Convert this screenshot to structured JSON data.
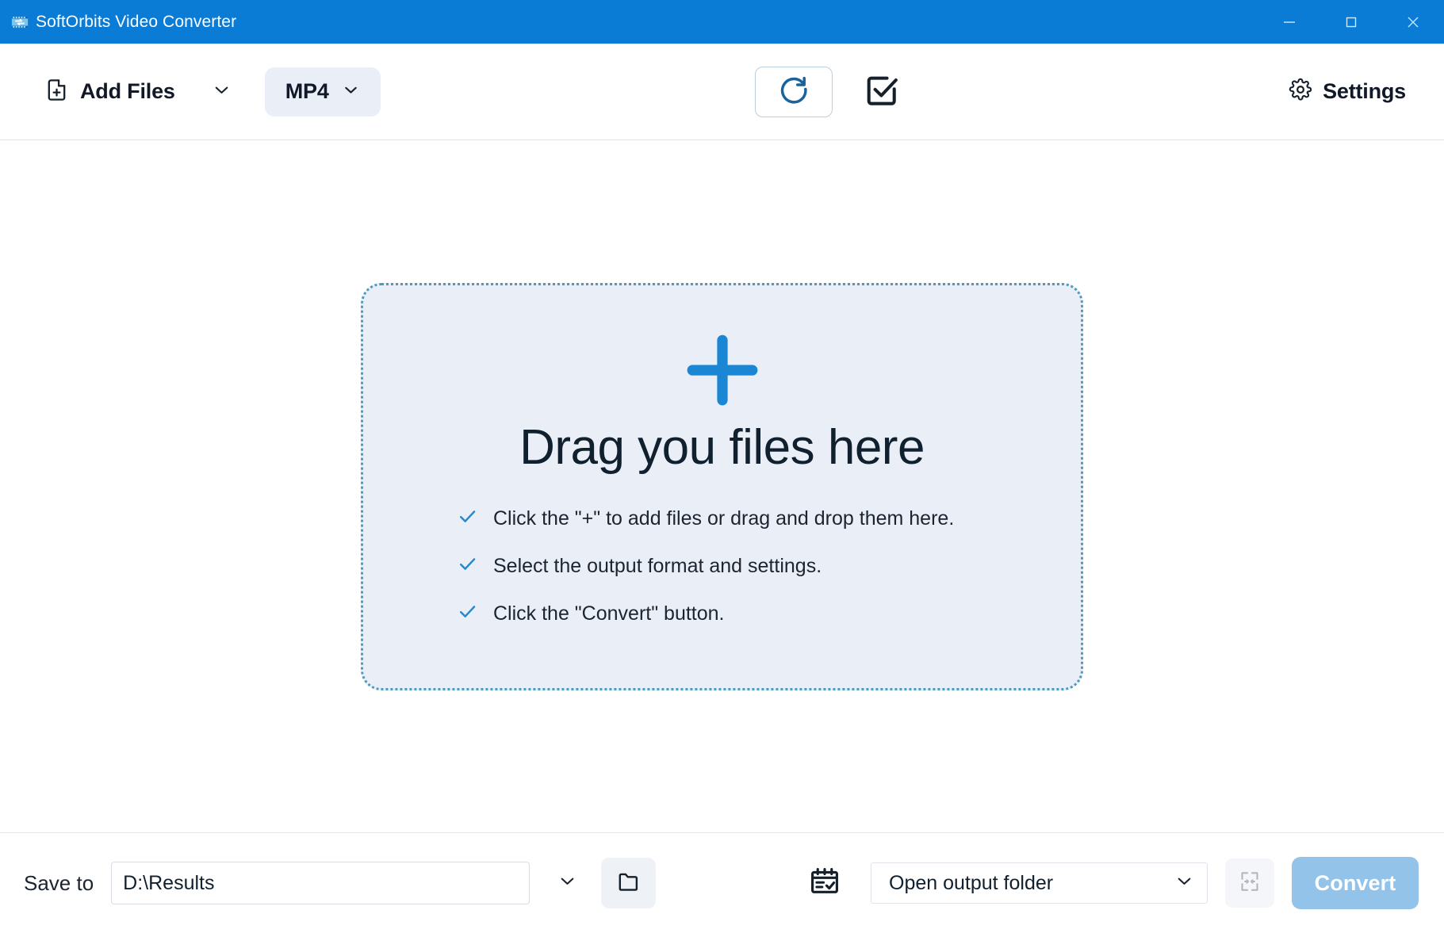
{
  "window": {
    "title": "SoftOrbits Video Converter",
    "icon": "video-converter-icon",
    "titlebar_color": "#0a7cd6",
    "controls": {
      "minimize": "minimize-icon",
      "maximize": "maximize-icon",
      "close": "close-icon"
    }
  },
  "toolbar": {
    "add_files_label": "Add Files",
    "add_files_icon": "file-plus-icon",
    "add_files_chevron": "chevron-down-icon",
    "format_label": "MP4",
    "format_chevron": "chevron-down-icon",
    "rotate_icon": "rotate-clockwise-icon",
    "select_all_icon": "checkbox-checked-icon",
    "settings_label": "Settings",
    "settings_icon": "gear-icon"
  },
  "dropzone": {
    "plus_icon": "plus-icon",
    "title": "Drag you files here",
    "hints": [
      {
        "icon": "check-icon",
        "text": "Click the \"+\" to add files or drag and drop them here."
      },
      {
        "icon": "check-icon",
        "text": "Select the output format and settings."
      },
      {
        "icon": "check-icon",
        "text": "Click the \"Convert\" button."
      }
    ]
  },
  "bottombar": {
    "save_to_label": "Save to",
    "path_value": "D:\\Results",
    "path_placeholder": "D:\\Results",
    "path_chevron": "chevron-down-icon",
    "browse_icon": "folder-icon",
    "schedule_icon": "calendar-check-icon",
    "after_action_value": "Open output folder",
    "after_action_chevron": "chevron-down-icon",
    "merge_icon": "merge-files-icon",
    "convert_label": "Convert"
  },
  "colors": {
    "accent_blue": "#0a7cd6",
    "plus_blue": "#1b86d3",
    "dropzone_bg": "#eaeff7",
    "dropzone_border": "#4a9bbd",
    "convert_disabled": "#94c3ea",
    "check_blue": "#2a87c5"
  }
}
